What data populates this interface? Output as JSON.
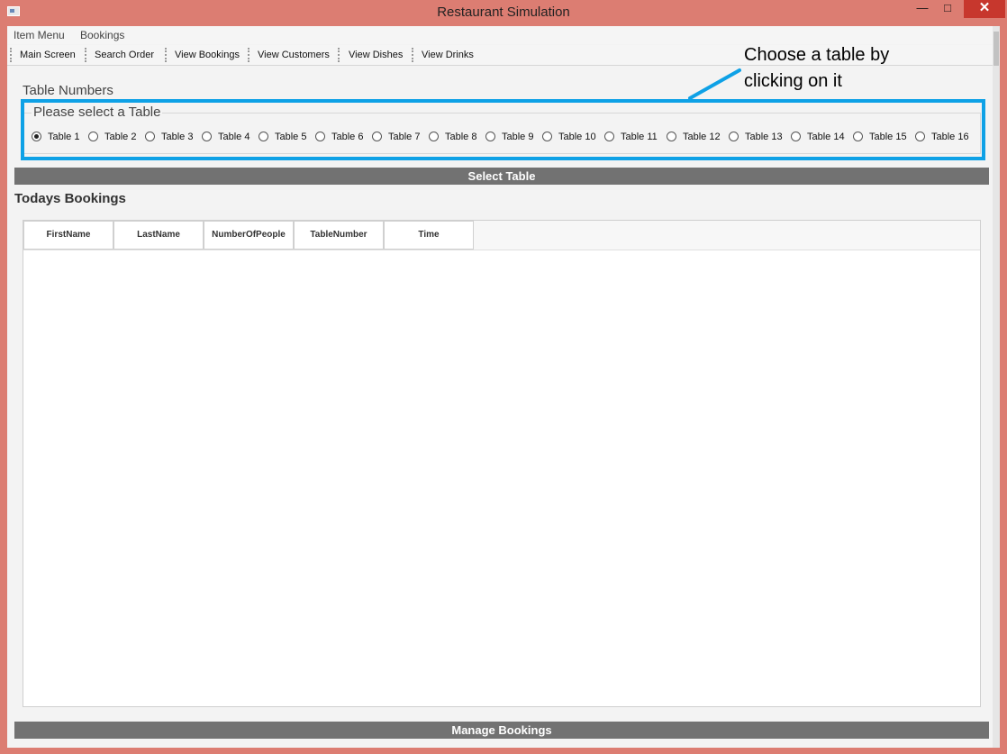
{
  "window": {
    "title": "Restaurant Simulation",
    "controls": {
      "minimize": "—",
      "maximize": "□",
      "close": "✕"
    }
  },
  "menubar": [
    "Item Menu",
    "Bookings"
  ],
  "toolbar": [
    "Main Screen",
    "Search Order",
    "View Bookings",
    "View Customers",
    "View Dishes",
    "View Drinks"
  ],
  "table_section": {
    "label": "Table Numbers",
    "group_title": "Please select a Table",
    "selected": "Table 1",
    "options": [
      "Table 1",
      "Table 2",
      "Table 3",
      "Table 4",
      "Table 5",
      "Table 6",
      "Table 7",
      "Table 8",
      "Table 9",
      "Table 10",
      "Table 11",
      "Table 12",
      "Table 13",
      "Table 14",
      "Table 15",
      "Table 16"
    ]
  },
  "annotation": {
    "text": "Choose a table by clicking on it",
    "color": "#0ea1e6"
  },
  "select_button": "Select Table",
  "bookings": {
    "title": "Todays Bookings",
    "columns": [
      "FirstName",
      "LastName",
      "NumberOfPeople",
      "TableNumber",
      "Time"
    ],
    "rows": []
  },
  "manage_button": "Manage Bookings"
}
